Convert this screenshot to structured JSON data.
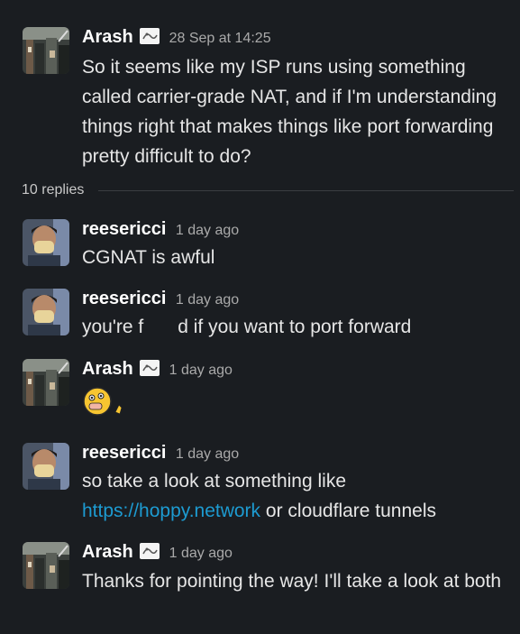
{
  "thread": {
    "parent": {
      "author": "Arash",
      "timestamp": "28 Sep at 14:25",
      "text": "So it seems like my ISP runs using something called carrier-grade NAT, and if I'm understanding things right that makes things like port forwarding pretty difficult to do?"
    },
    "replies_label": "10 replies",
    "messages": [
      {
        "author": "reesericci",
        "timestamp": "1 day ago",
        "text": "CGNAT is awful"
      },
      {
        "author": "reesericci",
        "timestamp": "1 day ago",
        "text_before": "you're f",
        "text_after": "d if you want to port forward"
      },
      {
        "author": "Arash",
        "timestamp": "1 day ago",
        "reaction_icon": "emoji-thumbs-up-face"
      },
      {
        "author": "reesericci",
        "timestamp": "1 day ago",
        "text_before": "so take a look at something like",
        "link": "https://hoppy.network",
        "text_after": " or cloudflare tunnels"
      },
      {
        "author": "Arash",
        "timestamp": "1 day ago",
        "text": "Thanks for pointing the way! I'll take a look at both"
      }
    ]
  },
  "colors": {
    "background": "#1a1d21",
    "text": "#e6e6e6",
    "link": "#1d9bd1",
    "muted": "#aaaaaa"
  },
  "icons": [
    "avatar-arash",
    "avatar-reesericci",
    "status-emoji-icon",
    "reaction-emoji-icon"
  ]
}
